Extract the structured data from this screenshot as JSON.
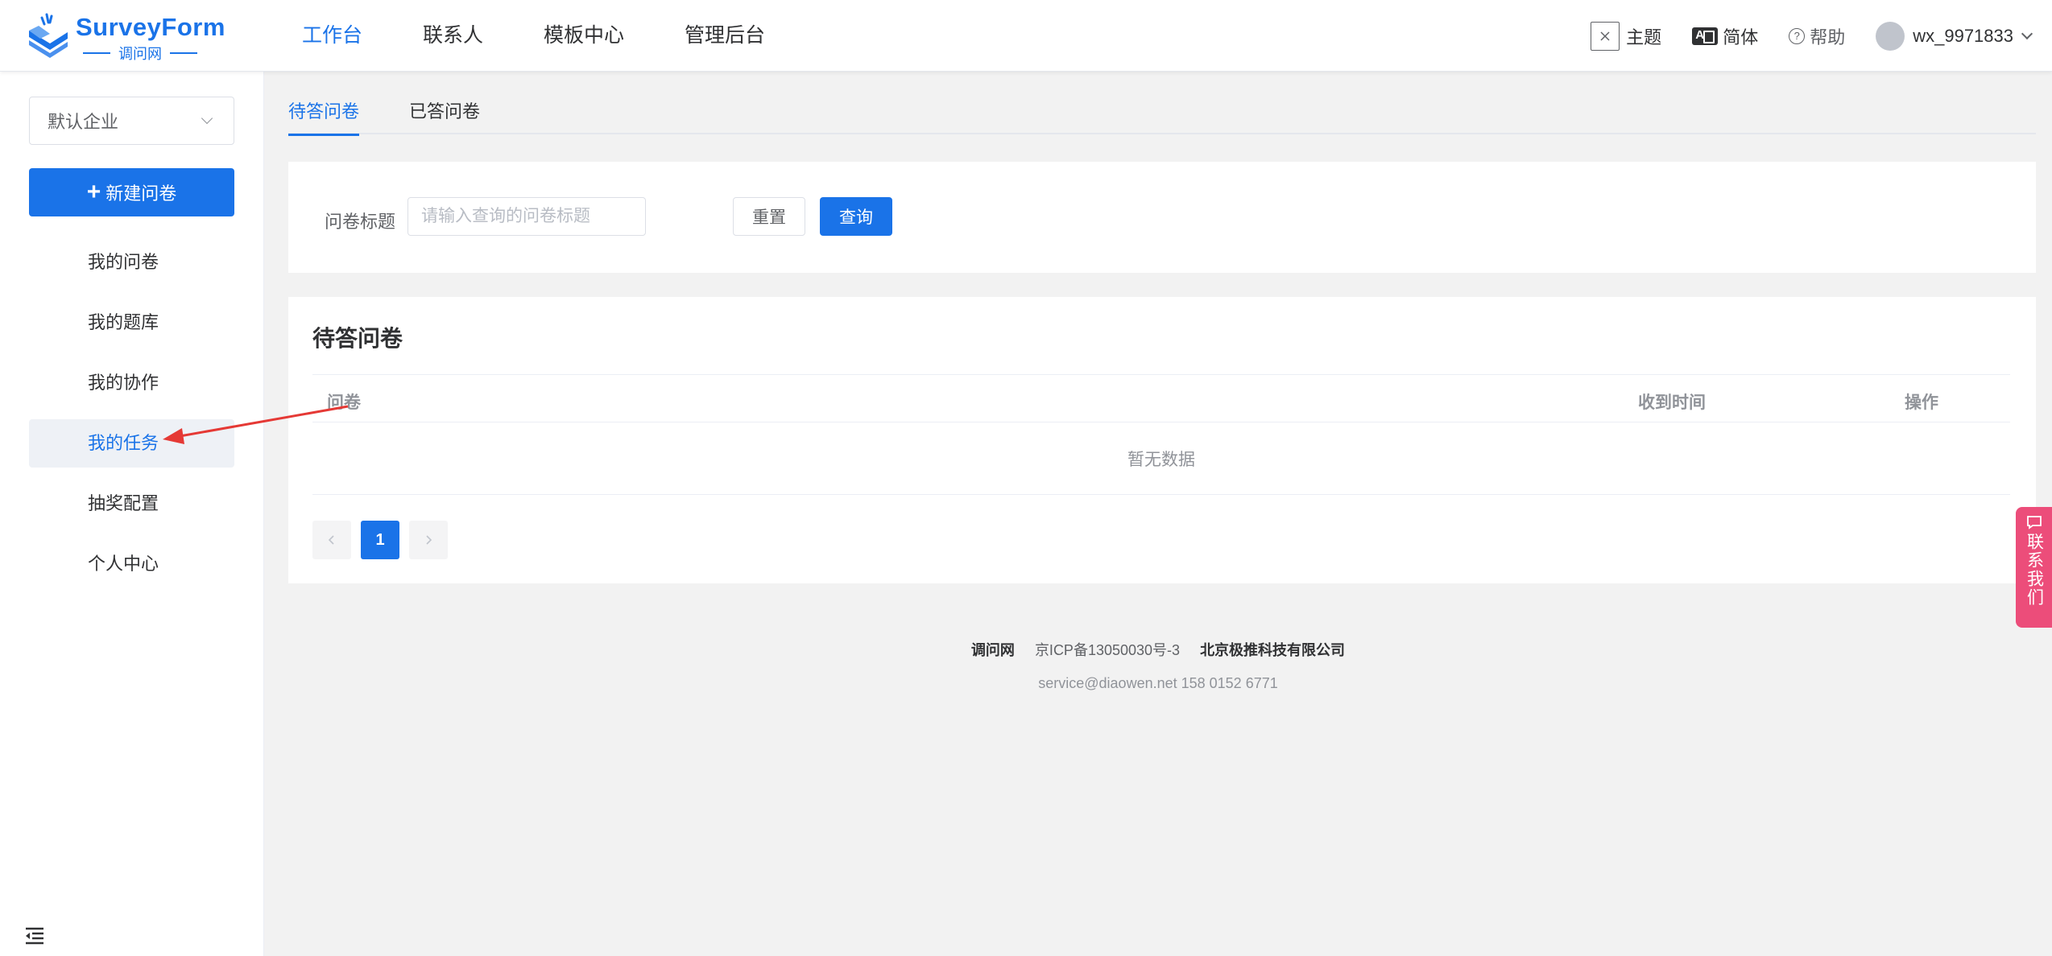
{
  "brand": {
    "name": "SurveyForm",
    "sub": "调问网",
    "color": "#1a73e8"
  },
  "nav": {
    "items": [
      {
        "label": "工作台",
        "active": true
      },
      {
        "label": "联系人"
      },
      {
        "label": "模板中心"
      },
      {
        "label": "管理后台"
      }
    ]
  },
  "tools": {
    "theme_icon": "close-square-icon",
    "theme_label": "主题",
    "lang_icon": "translate-icon",
    "lang_label": "简体",
    "help_icon": "question-circle-icon",
    "help_label": "帮助",
    "user_name": "wx_9971833"
  },
  "sidebar": {
    "company": "默认企业",
    "new_button": "新建问卷",
    "items": [
      {
        "label": "我的问卷"
      },
      {
        "label": "我的题库"
      },
      {
        "label": "我的协作"
      },
      {
        "label": "我的任务",
        "active": true
      },
      {
        "label": "抽奖配置"
      },
      {
        "label": "个人中心"
      }
    ]
  },
  "tabs": [
    {
      "label": "待答问卷",
      "active": true
    },
    {
      "label": "已答问卷"
    }
  ],
  "filter": {
    "label": "问卷标题",
    "placeholder": "请输入查询的问卷标题",
    "value": "",
    "reset": "重置",
    "query": "查询"
  },
  "list": {
    "title": "待答问卷",
    "columns": [
      "问卷",
      "收到时间",
      "操作"
    ],
    "empty": "暂无数据",
    "page": "1"
  },
  "footer": {
    "site": "调问网",
    "icp": "京ICP备13050030号-3",
    "company": "北京极推科技有限公司",
    "contact": "service@diaowen.net 158 0152 6771"
  },
  "contact_float": {
    "label": "联系我们",
    "color": "#ec4d7a"
  },
  "annotation": {
    "color": "#e53935"
  }
}
